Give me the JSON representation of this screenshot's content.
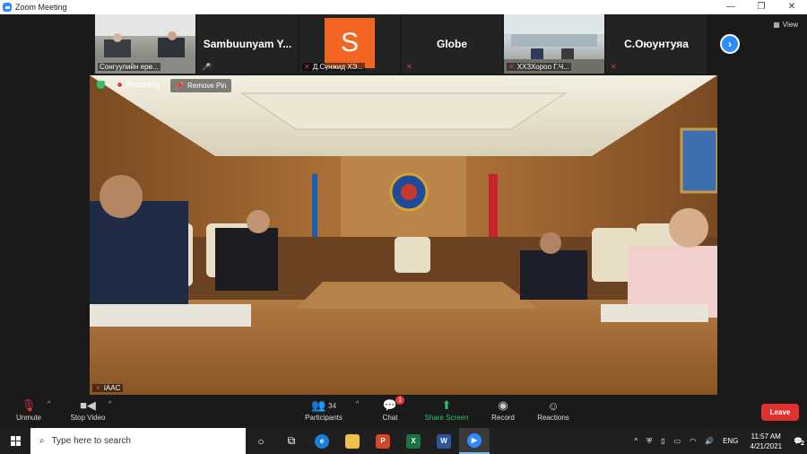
{
  "window": {
    "title": "Zoom Meeting"
  },
  "gallery": [
    {
      "label": "Сонгуулийн ерө...",
      "type": "video"
    },
    {
      "label": "Sambuunyam Y...",
      "type": "name"
    },
    {
      "label": "Д.Сүнжид ХЭ...",
      "type": "avatar",
      "initial": "S"
    },
    {
      "label": "Globe",
      "type": "name"
    },
    {
      "label": "ХХЗХороо Г.Ч...",
      "type": "video"
    },
    {
      "label": "С.Оюунтуяа",
      "type": "name"
    }
  ],
  "view_label": "View",
  "main_video": {
    "recording_label": "Recording",
    "remove_pin_label": "Remove Pin",
    "speaker_label": "IAAC"
  },
  "toolbar": {
    "unmute": "Unmute",
    "stop_video": "Stop Video",
    "participants": "Participants",
    "participants_count": "34",
    "chat": "Chat",
    "chat_badge": "1",
    "share_screen": "Share Screen",
    "record": "Record",
    "reactions": "Reactions",
    "leave": "Leave"
  },
  "taskbar": {
    "search_placeholder": "Type here to search",
    "language": "ENG",
    "time": "11:57 AM",
    "date": "4/21/2021",
    "notification_count": "2"
  },
  "colors": {
    "zoom_blue": "#2d8cff",
    "leave_red": "#e0312f",
    "share_green": "#2ec26b"
  }
}
